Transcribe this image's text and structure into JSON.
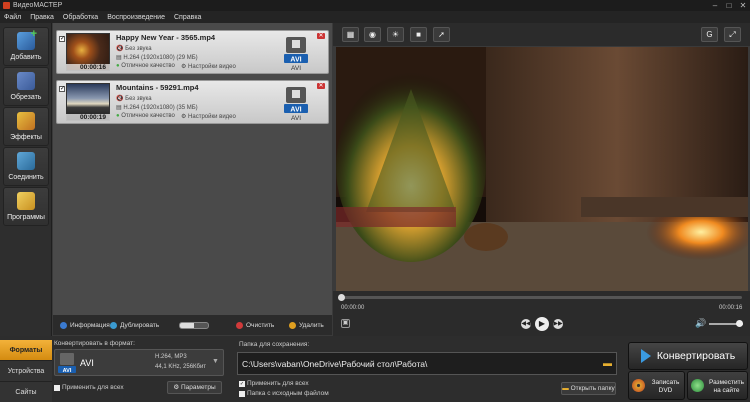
{
  "window": {
    "title": "ВидеоМАСТЕР"
  },
  "menu": [
    "Файл",
    "Правка",
    "Обработка",
    "Воспроизведение",
    "Справка"
  ],
  "sidebar": [
    {
      "label": "Добавить",
      "icon": "add-video-icon",
      "color": "#3a9a4a"
    },
    {
      "label": "Обрезать",
      "icon": "cut-video-icon",
      "color": "#3a6fb0"
    },
    {
      "label": "Эффекты",
      "icon": "effects-icon",
      "color": "#c8a020"
    },
    {
      "label": "Соединить",
      "icon": "join-icon",
      "color": "#3a8ac0"
    },
    {
      "label": "Программы",
      "icon": "programs-icon",
      "color": "#e0b030"
    }
  ],
  "files": [
    {
      "name": "Happy New Year - 3565.mp4",
      "duration": "00:00:16",
      "audio": "Без звука",
      "video": "H.264 (1920x1080) (29 МБ)",
      "quality": "Отличное качество",
      "settings": "Настройки видео",
      "format": "AVI"
    },
    {
      "name": "Mountains - 59291.mp4",
      "duration": "00:00:19",
      "audio": "Без звука",
      "video": "H.264 (1920x1080) (35 МБ)",
      "quality": "Отличное качество",
      "settings": "Настройки видео",
      "format": "AVI"
    }
  ],
  "list_toolbar": {
    "info": "Информация",
    "duplicate": "Дублировать",
    "clear": "Очистить",
    "delete": "Удалить"
  },
  "player": {
    "time_current": "00:00:00",
    "time_total": "00:00:16"
  },
  "bottom_tabs": [
    "Форматы",
    "Устройства",
    "Сайты"
  ],
  "convert_format": {
    "label": "Конвертировать в формат:",
    "format": "AVI",
    "codec": "H.264, MP3",
    "audio": "44,1 KHz, 256Кбит",
    "apply_all": "Применить для всех",
    "params": "Параметры"
  },
  "save_folder": {
    "label": "Папка для сохранения:",
    "path": "C:\\Users\\vaban\\OneDrive\\Рабочий стол\\Работа\\",
    "apply_all": "Применить для всех",
    "source_folder": "Папка с исходным файлом",
    "open_folder": "Открыть папку"
  },
  "actions": {
    "convert": "Конвертировать",
    "burn_dvd": "Записать DVD",
    "publish": "Разместить на сайте"
  }
}
